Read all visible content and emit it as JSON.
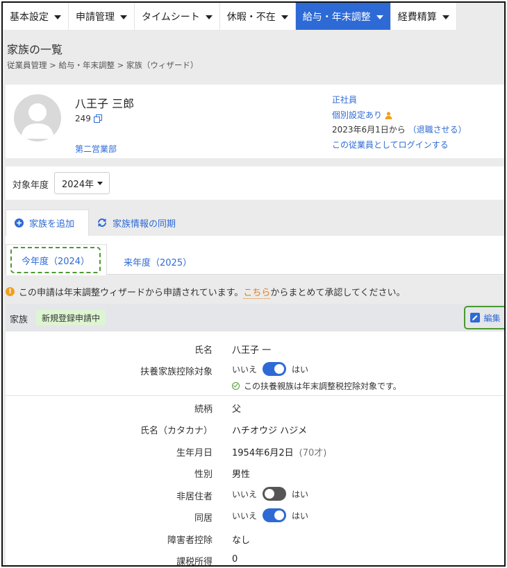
{
  "nav": {
    "tabs": [
      {
        "label": "基本設定"
      },
      {
        "label": "申請管理"
      },
      {
        "label": "タイムシート"
      },
      {
        "label": "休暇・不在"
      },
      {
        "label": "給与・年末調整"
      },
      {
        "label": "経費精算"
      }
    ],
    "active_index": 4
  },
  "page": {
    "title": "家族の一覧",
    "breadcrumb": "従業員管理 > 給与・年末調整 > 家族（ウィザード）"
  },
  "employee": {
    "name": "八王子 三郎",
    "id": "249",
    "department": "第二営業部",
    "type": "正社員",
    "custom_setting": "個別設定あり",
    "start": "2023年6月1日から",
    "retire_link": "（退職させる）",
    "login_link": "この従業員としてログインする"
  },
  "year_select": {
    "label": "対象年度",
    "value": "2024年"
  },
  "actions": {
    "add_family": "家族を追加",
    "sync": "家族情報の同期"
  },
  "year_tabs": {
    "current": "今年度（2024）",
    "next": "来年度（2025）"
  },
  "notice": {
    "before": "この申請は年末調整ウィザードから申請されています。",
    "link": "こちら",
    "after": "からまとめて承認してください。"
  },
  "family": {
    "section_title": "家族",
    "badge": "新規登録申請中",
    "edit_label": "編集",
    "toggle_no": "いいえ",
    "toggle_yes": "はい",
    "fields": {
      "name_label": "氏名",
      "name_value": "八王子 一",
      "dependent_label": "扶養家族控除対象",
      "dependent_on": true,
      "dependent_note": "この扶養親族は年末調整税控除対象です。",
      "relation_label": "続柄",
      "relation_value": "父",
      "kana_label": "氏名（カタカナ）",
      "kana_value": "ハチオウジ ハジメ",
      "birth_label": "生年月日",
      "birth_value": "1954年6月2日",
      "age": "(70才)",
      "gender_label": "性別",
      "gender_value": "男性",
      "nonresident_label": "非居住者",
      "nonresident_on": false,
      "cohabit_label": "同居",
      "cohabit_on": true,
      "disability_label": "障害者控除",
      "disability_value": "なし",
      "income_label": "課税所得",
      "income_value": "0"
    }
  }
}
